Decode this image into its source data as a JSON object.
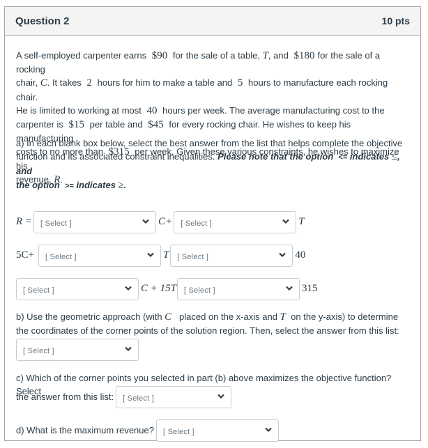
{
  "question": {
    "title": "Question 2",
    "points": "10 pts"
  },
  "problem": {
    "line1_a": "A self-employed carpenter earns",
    "price_table": "$90",
    "line1_b": "for the sale of a table,",
    "var_table": "T",
    "line1_c": ", and",
    "price_chair": "$180",
    "line1_d": "for the sale of a rocking",
    "line2_a": "chair,",
    "var_chair": "C",
    "line2_b": ". It takes",
    "hours_table": "2",
    "line2_c": "hours for him to make a table and",
    "hours_chair": "5",
    "line2_d": "hours to manufacture each rocking chair.",
    "line3_a": "He is limited to working at most",
    "hours_max": "40",
    "line3_b": "hours per week. The average manufacturing cost to the",
    "line4_a": "carpenter is",
    "cost_table": "$15",
    "line4_b": "per table and",
    "cost_chair": "$45",
    "line4_c": "for every rocking chair. He wishes to keep his manufacturing",
    "line5_a": "costs to no more than",
    "cost_max": "$315",
    "line5_b": "per week. Given these various constraints, he wishes to maximize his",
    "line6_a": "revenue,",
    "var_revenue": "R",
    "line6_b": "."
  },
  "part_a": {
    "text1": "a) In each blank box below, select the best answer from the list that helps complete the objective",
    "text2": "function and its associated constraint inequalities.",
    "note1": "Please note that  the option",
    "le_option": "<=",
    "note2": "indicates",
    "le_symbol": "≤",
    "note3": ", and",
    "note4": "the option",
    "ge_option": ">=",
    "note5": "indicates",
    "ge_symbol": "≥",
    "note6": ".",
    "row1": {
      "prefix": "R =",
      "mid": "C+",
      "suffix": "T"
    },
    "row2": {
      "prefix": "5C+",
      "mid": "T",
      "suffix": "40"
    },
    "row3": {
      "mid": "C + 15T",
      "suffix": "315"
    }
  },
  "part_b": {
    "text1_a": "b) Use the geometric approach (with",
    "var_x": "C",
    "text1_b": "placed on the x-axis and",
    "var_y": "T",
    "text1_c": "on the y-axis)  to determine",
    "text2": "the coordinates of the corner points of the solution region. Then, select the answer from this list:"
  },
  "part_c": {
    "text1": "c) Which of the corner points you selected in part (b) above maximizes the objective function? Select",
    "text2": "the answer from this list:"
  },
  "part_d": {
    "text1": "d) What is the maximum revenue?"
  },
  "select_placeholder": "[ Select ]"
}
